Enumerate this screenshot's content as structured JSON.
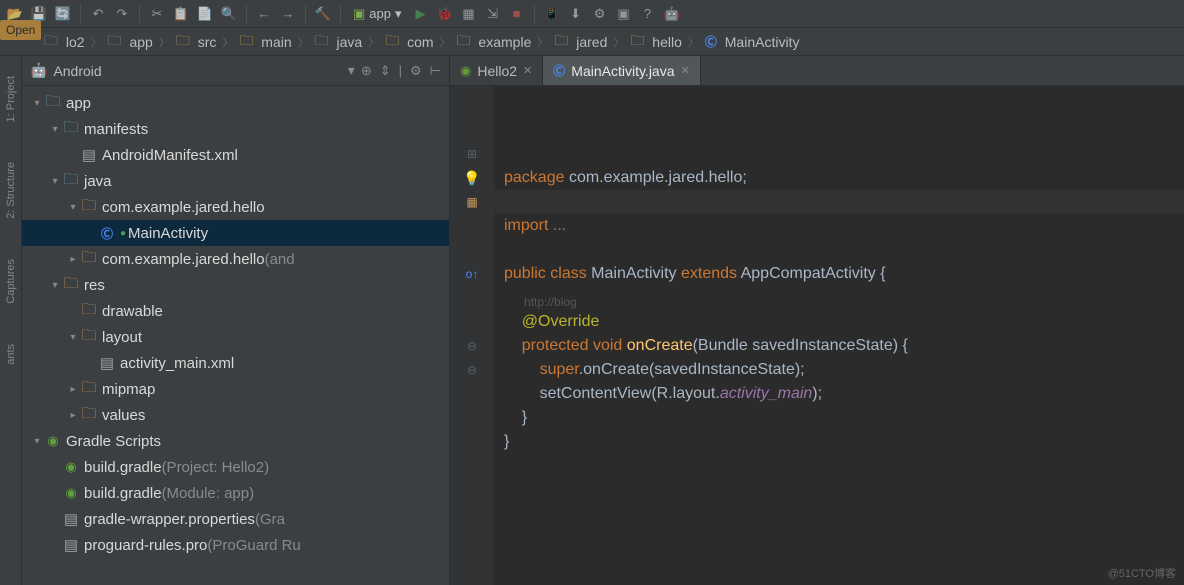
{
  "open_tooltip": "Open",
  "app_selector": "app",
  "breadcrumb": [
    {
      "icon": "folder-blue",
      "label": "lo2"
    },
    {
      "icon": "folder-blue",
      "label": "app"
    },
    {
      "icon": "folder",
      "label": "src"
    },
    {
      "icon": "folder",
      "label": "main"
    },
    {
      "icon": "folder-blue",
      "label": "java"
    },
    {
      "icon": "folder",
      "label": "com"
    },
    {
      "icon": "folder",
      "label": "example"
    },
    {
      "icon": "folder",
      "label": "jared"
    },
    {
      "icon": "folder",
      "label": "hello"
    },
    {
      "icon": "class",
      "label": "MainActivity"
    }
  ],
  "panel": {
    "title": "Android",
    "dropdown_icon": "▾"
  },
  "gutter_labels": [
    "1: Project",
    "2: Structure",
    "Captures",
    "ants"
  ],
  "tree": [
    {
      "indent": 0,
      "arrow": "▾",
      "icon": "folder-blue",
      "label": "app"
    },
    {
      "indent": 1,
      "arrow": "▾",
      "icon": "folder-blue",
      "label": "manifests"
    },
    {
      "indent": 2,
      "arrow": "",
      "icon": "file",
      "label": "AndroidManifest.xml"
    },
    {
      "indent": 1,
      "arrow": "▾",
      "icon": "folder-blue",
      "label": "java"
    },
    {
      "indent": 2,
      "arrow": "▾",
      "icon": "folder",
      "label": "com.example.jared.hello"
    },
    {
      "indent": 3,
      "arrow": "",
      "icon": "class",
      "label": "MainActivity",
      "selected": true,
      "green_dot": true
    },
    {
      "indent": 2,
      "arrow": "▸",
      "icon": "folder",
      "label": "com.example.jared.hello",
      "dim_suffix": " (and"
    },
    {
      "indent": 1,
      "arrow": "▾",
      "icon": "folder",
      "label": "res"
    },
    {
      "indent": 2,
      "arrow": "",
      "icon": "folder",
      "label": "drawable"
    },
    {
      "indent": 2,
      "arrow": "▾",
      "icon": "folder",
      "label": "layout"
    },
    {
      "indent": 3,
      "arrow": "",
      "icon": "file",
      "label": "activity_main.xml"
    },
    {
      "indent": 2,
      "arrow": "▸",
      "icon": "folder",
      "label": "mipmap"
    },
    {
      "indent": 2,
      "arrow": "▸",
      "icon": "folder",
      "label": "values"
    },
    {
      "indent": 0,
      "arrow": "▾",
      "icon": "gradle",
      "label": "Gradle Scripts"
    },
    {
      "indent": 1,
      "arrow": "",
      "icon": "gradle",
      "label": "build.gradle",
      "dim_suffix": " (Project: Hello2)"
    },
    {
      "indent": 1,
      "arrow": "",
      "icon": "gradle",
      "label": "build.gradle",
      "dim_suffix": " (Module: app)"
    },
    {
      "indent": 1,
      "arrow": "",
      "icon": "file",
      "label": "gradle-wrapper.properties",
      "dim_suffix": " (Gra"
    },
    {
      "indent": 1,
      "arrow": "",
      "icon": "file",
      "label": "proguard-rules.pro",
      "dim_suffix": " (ProGuard Ru"
    }
  ],
  "tabs": [
    {
      "icon": "gradle",
      "label": "Hello2",
      "active": false
    },
    {
      "icon": "class",
      "label": "MainActivity.java",
      "active": true
    }
  ],
  "code": {
    "l1_kw": "package",
    "l1_rest": " com.example.jared.hello;",
    "l2_kw": "import",
    "l2_rest": " ...",
    "l3_kw1": "public",
    "l3_kw2": "class",
    "l3_cls": "MainActivity",
    "l3_kw3": "extends",
    "l3_ext": "AppCompatActivity {",
    "l4_ann": "@Override",
    "l5_kw1": "protected",
    "l5_kw2": "void",
    "l5_mth": "onCreate",
    "l5_rest": "(Bundle savedInstanceState) {",
    "l6_kw": "super",
    "l6_rest": ".onCreate(savedInstanceState);",
    "l7_a": "setContentView(R.layout.",
    "l7_field": "activity_main",
    "l7_b": ");",
    "l8": "}",
    "l9": "}"
  },
  "blog_watermark": "http://blog",
  "watermark": "@51CTO博客"
}
